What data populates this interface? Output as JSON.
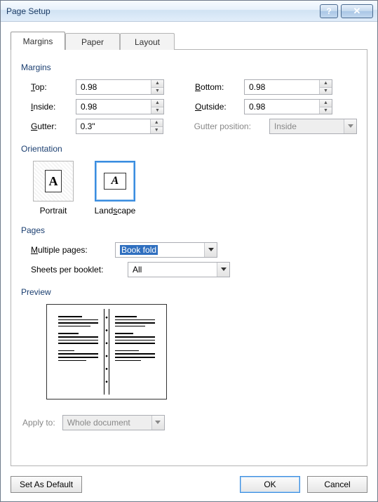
{
  "window": {
    "title": "Page Setup"
  },
  "tabs": {
    "margins": "Margins",
    "paper": "Paper",
    "layout": "Layout"
  },
  "section": {
    "margins": "Margins",
    "orientation": "Orientation",
    "pages": "Pages",
    "preview": "Preview"
  },
  "margins": {
    "top_label_pre": "",
    "top_key": "T",
    "top_label_post": "op:",
    "bottom_label_pre": "",
    "bottom_key": "B",
    "bottom_label_post": "ottom:",
    "inside_label_pre": "",
    "inside_key": "I",
    "inside_label_post": "nside:",
    "outside_label_pre": "",
    "outside_key": "O",
    "outside_label_post": "utside:",
    "gutter_label_pre": "",
    "gutter_key": "G",
    "gutter_label_post": "utter:",
    "gutterpos_label": "Gutter position:",
    "top": "0.98",
    "bottom": "0.98",
    "inside": "0.98",
    "outside": "0.98",
    "gutter": "0.3\"",
    "gutter_position": "Inside"
  },
  "orientation": {
    "portrait": "Portrait",
    "landscape_pre": "Land",
    "landscape_key": "s",
    "landscape_post": "cape"
  },
  "pages": {
    "multi_pre": "",
    "multi_key": "M",
    "multi_post": "ultiple pages:",
    "multi_value": "Book fold",
    "sheets_label": "Sheets per booklet:",
    "sheets_value": "All"
  },
  "apply": {
    "label": "Apply to:",
    "value": "Whole document"
  },
  "buttons": {
    "set_default": "Set As Default",
    "ok": "OK",
    "cancel": "Cancel"
  }
}
